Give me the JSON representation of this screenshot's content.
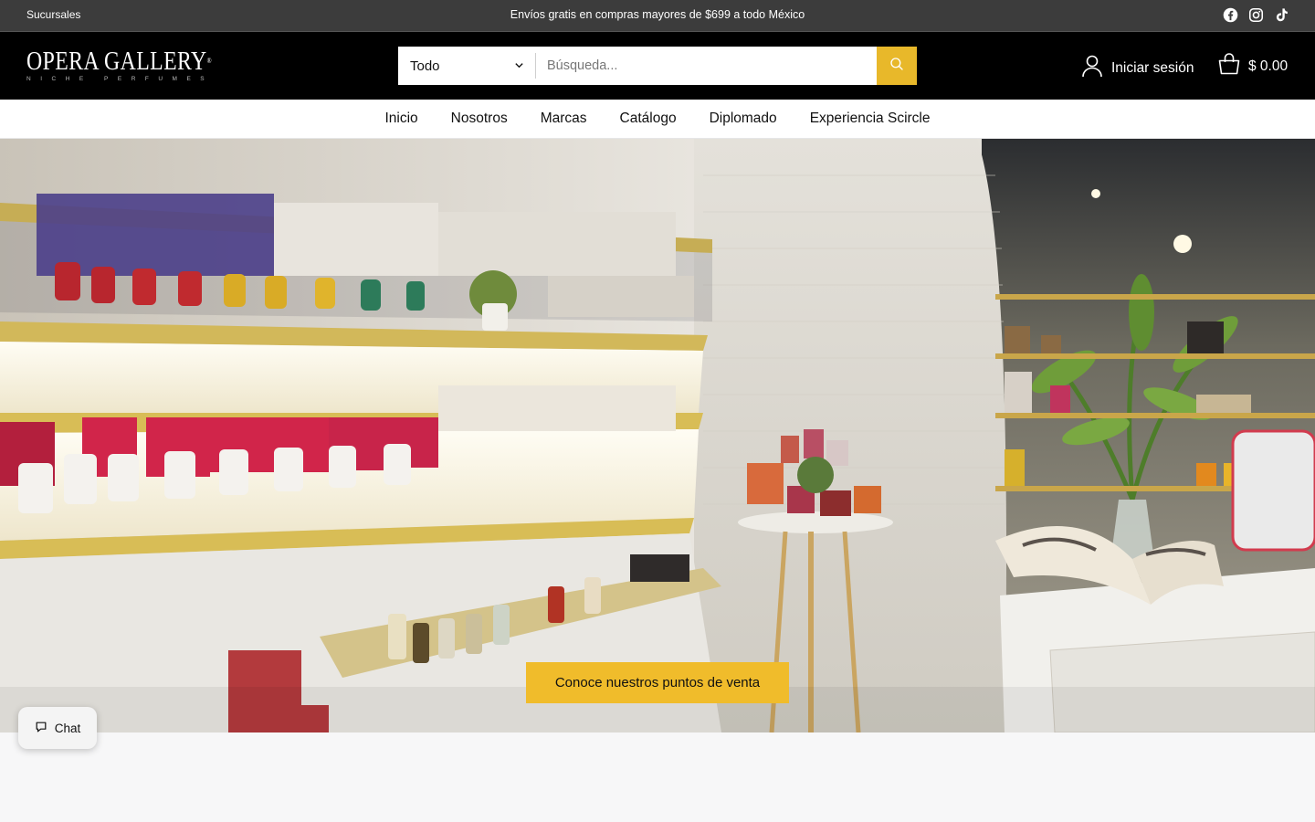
{
  "topbar": {
    "branches_label": "Sucursales",
    "promo_text": "Envíos gratis en compras mayores de $699 a todo México",
    "social_icons": [
      "facebook-icon",
      "instagram-icon",
      "tiktok-icon"
    ]
  },
  "header": {
    "logo_text": "OPERA GALLERY",
    "logo_tagline": "NICHE PERFUMES",
    "search": {
      "category_selected": "Todo",
      "placeholder": "Búsqueda...",
      "value": ""
    },
    "account_label": "Iniciar sesión",
    "cart_total": "$ 0.00"
  },
  "nav": {
    "items": [
      "Inicio",
      "Nosotros",
      "Marcas",
      "Catálogo",
      "Diplomado",
      "Experiencia Scircle"
    ]
  },
  "hero": {
    "cta_label": "Conoce nuestros puntos de venta"
  },
  "chat": {
    "label": "Chat"
  },
  "colors": {
    "topbar_bg": "#3c3c3c",
    "header_bg": "#000000",
    "accent": "#f0bc2b",
    "nav_bg": "#ffffff",
    "page_bg": "#f7f7f8"
  }
}
